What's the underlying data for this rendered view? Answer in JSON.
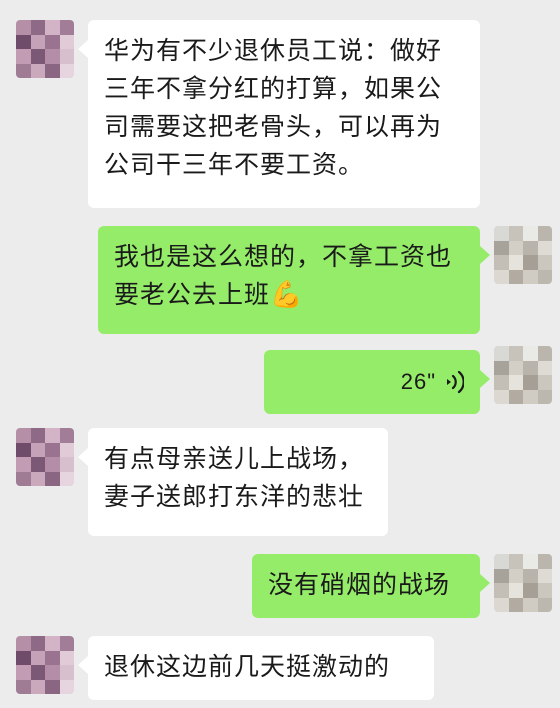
{
  "messages": [
    {
      "side": "in",
      "text": "华为有不少退休员工说：做好三年不拿分红的打算，如果公司需要这把老骨头，可以再为公司干三年不要工资。"
    },
    {
      "side": "out",
      "text": "我也是这么想的，不拿工资也要老公去上班",
      "emoji": "💪"
    },
    {
      "side": "out",
      "type": "voice",
      "duration": "26\""
    },
    {
      "side": "in",
      "text": "有点母亲送儿上战场，妻子送郎打东洋的悲壮"
    },
    {
      "side": "out",
      "text": "没有硝烟的战场"
    },
    {
      "side": "in",
      "text": "退休这边前几天挺激动的"
    }
  ],
  "colors": {
    "background": "#ececec",
    "incoming_bubble": "#ffffff",
    "outgoing_bubble": "#95ec69"
  },
  "icons": {
    "voice": "voice-wave-icon"
  }
}
